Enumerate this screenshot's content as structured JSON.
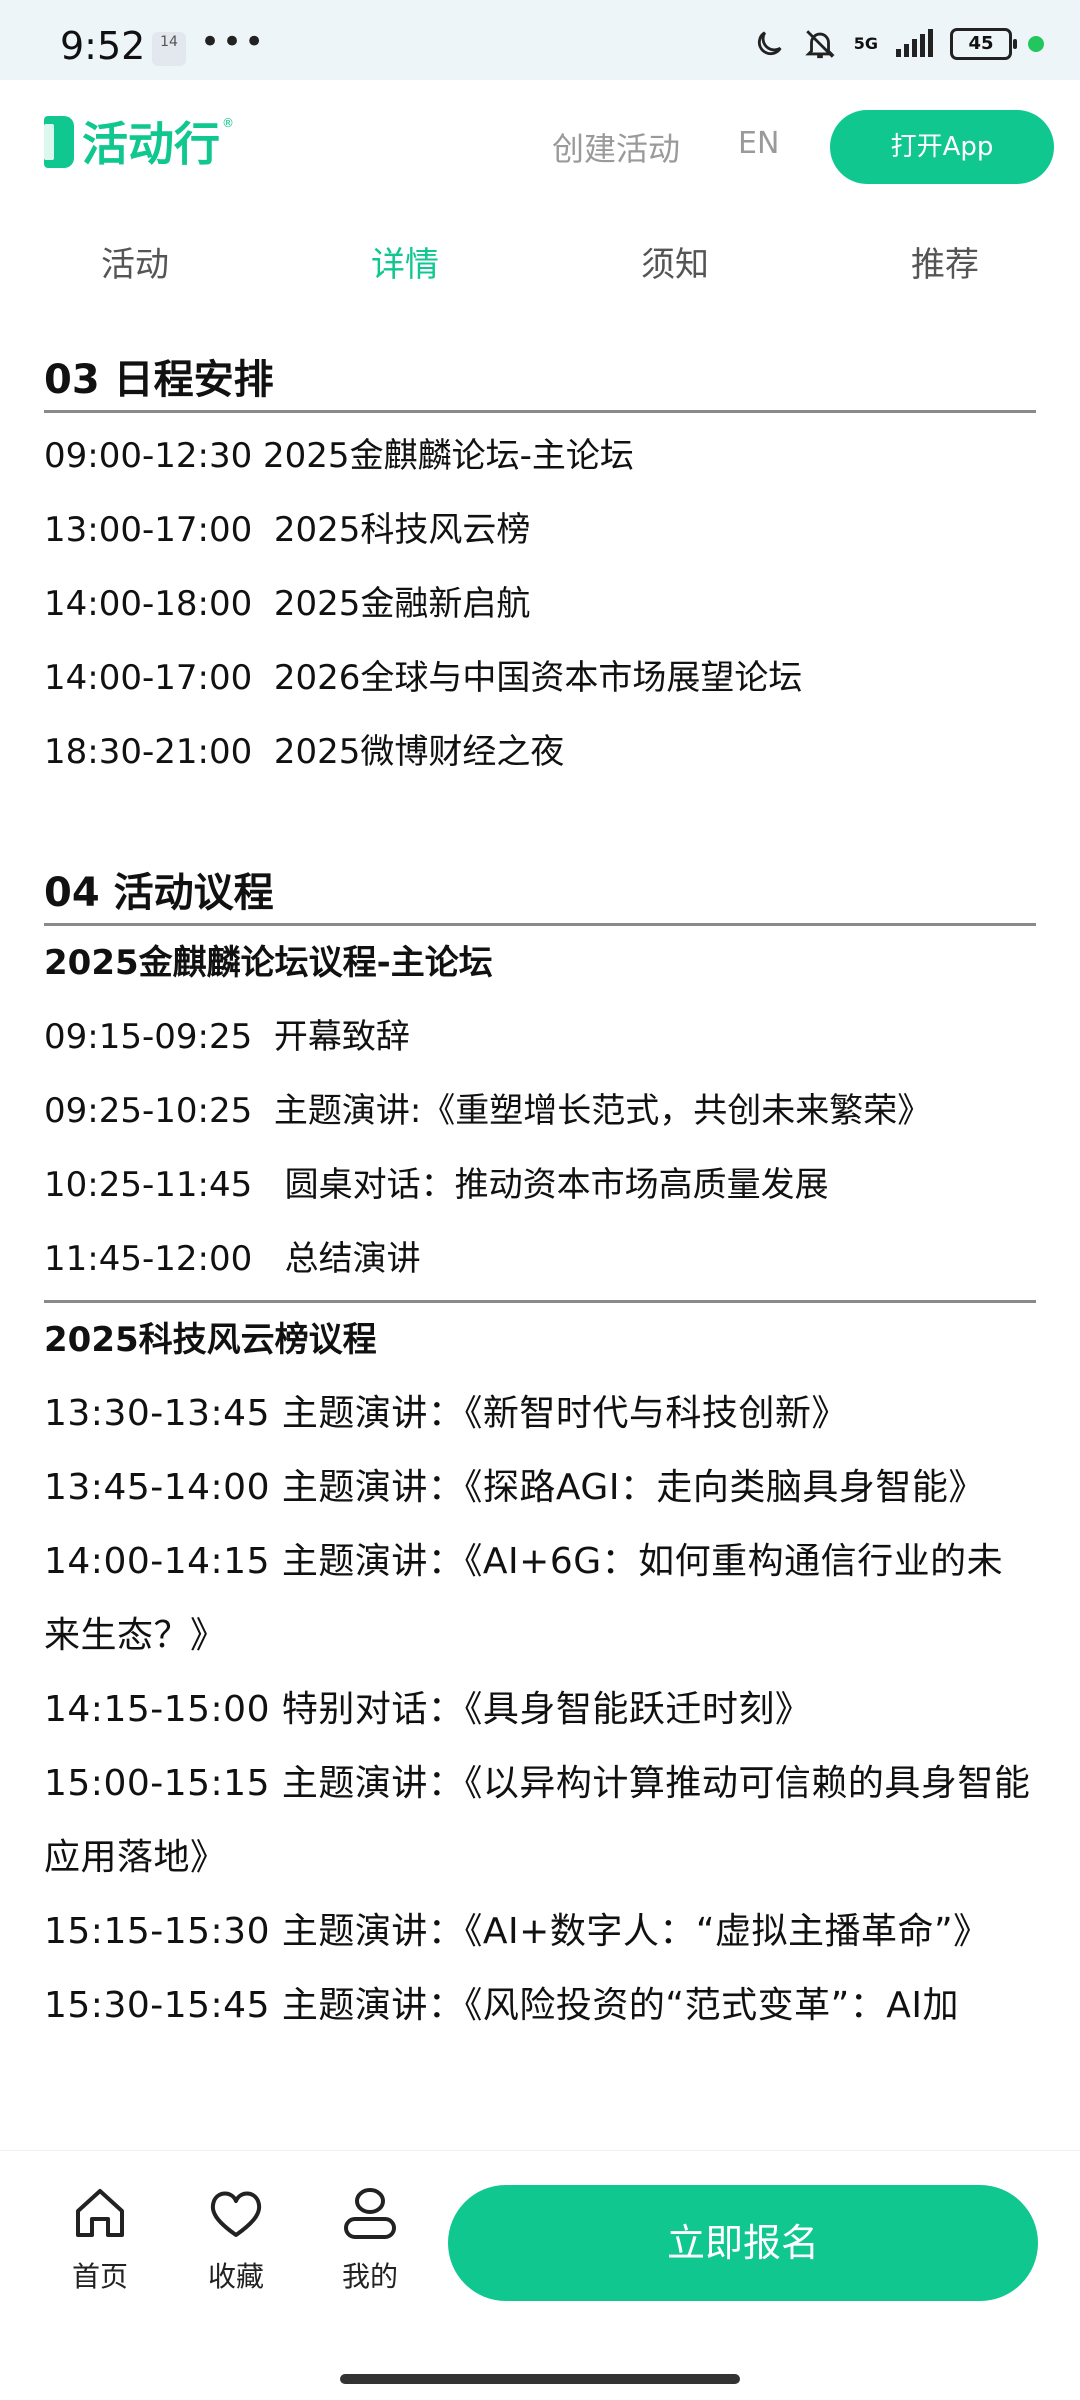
{
  "status_bar": {
    "time": "9:52",
    "notif_badge": "14",
    "more": "•••",
    "network": "5G",
    "battery": "45"
  },
  "header": {
    "logo": "活动行",
    "create_label": "创建活动",
    "lang_label": "EN",
    "open_app_label": "打开App",
    "accent_color": "#10c78f"
  },
  "tabs": [
    {
      "label": "活动",
      "active": false
    },
    {
      "label": "详情",
      "active": true
    },
    {
      "label": "须知",
      "active": false
    },
    {
      "label": "推荐",
      "active": false
    }
  ],
  "schedule": {
    "title": "03 日程安排",
    "items": [
      "09:00-12:30 2025金麒麟论坛-主论坛",
      "13:00-17:00  2025科技风云榜",
      "14:00-18:00  2025金融新启航",
      "14:00-17:00  2026全球与中国资本市场展望论坛",
      "18:30-21:00  2025微博财经之夜"
    ]
  },
  "agenda": {
    "title": "04 活动议程",
    "forum1": {
      "title": "2025金麒麟论坛议程-主论坛",
      "items": [
        "09:15-09:25  开幕致辞",
        "09:25-10:25  主题演讲:《重塑增长范式，共创未来繁荣》",
        "10:25-11:45   圆桌对话：推动资本市场高质量发展",
        "11:45-12:00   总结演讲"
      ]
    },
    "forum2": {
      "title": "2025科技风云榜议程",
      "items": [
        "13:30-13:45 主题演讲：《新智时代与科技创新》",
        "13:45-14:00 主题演讲：《探路AGI：走向类脑具身智能》",
        "14:00-14:15 主题演讲：《AI+6G：如何重构通信行业的未来生态？》",
        "14:15-15:00 特别对话：《具身智能跃迁时刻》",
        "15:00-15:15 主题演讲：《以异构计算推动可信赖的具身智能应用落地》",
        "15:15-15:30 主题演讲：《AI+数字人：“虚拟主播革命”》",
        "15:30-15:45 主题演讲：《风险投资的“范式变革”：AI加"
      ]
    }
  },
  "bottom_nav": {
    "home_label": "首页",
    "fav_label": "收藏",
    "me_label": "我的",
    "signup_label": "立即报名"
  }
}
